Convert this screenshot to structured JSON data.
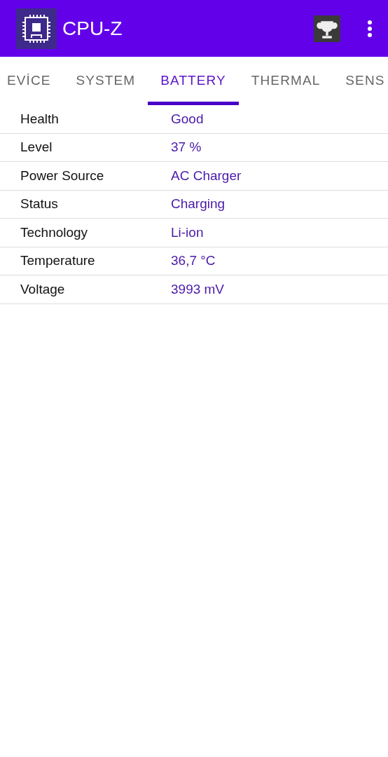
{
  "app_bar": {
    "title": "CPU-Z"
  },
  "tabs": [
    {
      "label": "EVİCE",
      "selected": false
    },
    {
      "label": "SYSTEM",
      "selected": false
    },
    {
      "label": "BATTERY",
      "selected": true
    },
    {
      "label": "THERMAL",
      "selected": false
    },
    {
      "label": "SENS",
      "selected": false
    }
  ],
  "rows": [
    {
      "label": "Health",
      "value": "Good"
    },
    {
      "label": "Level",
      "value": "37 %"
    },
    {
      "label": "Power Source",
      "value": "AC Charger"
    },
    {
      "label": "Status",
      "value": "Charging"
    },
    {
      "label": "Technology",
      "value": "Li-ion"
    },
    {
      "label": "Temperature",
      "value": "36,7 °C"
    },
    {
      "label": "Voltage",
      "value": "3993 mV"
    }
  ]
}
